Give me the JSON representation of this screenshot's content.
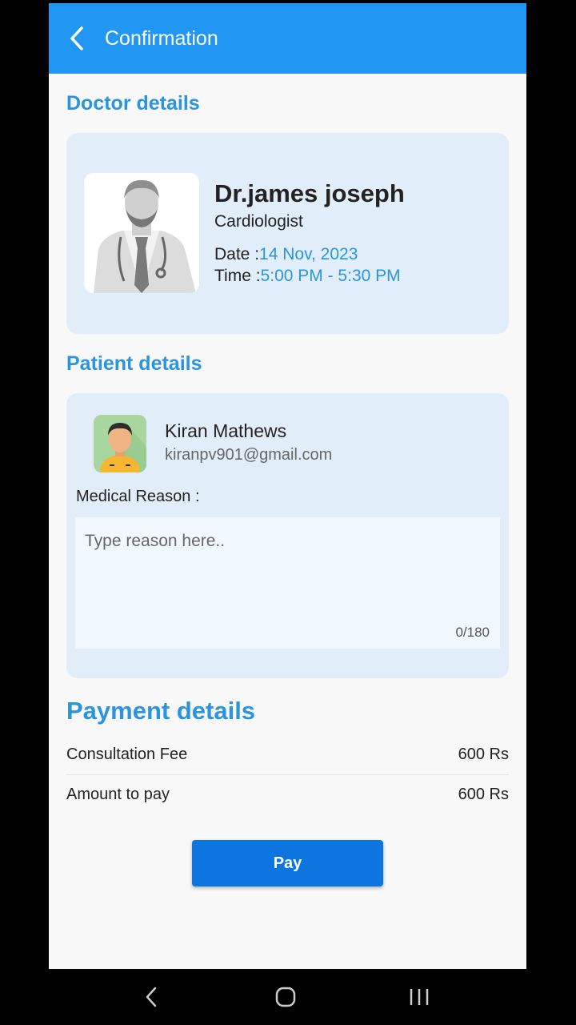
{
  "appbar": {
    "title": "Confirmation"
  },
  "doctor_section": {
    "heading": "Doctor details",
    "name": "Dr.james joseph",
    "specialty": "Cardiologist",
    "date_label": "Date :",
    "date_value": "14 Nov, 2023",
    "time_label": "Time :",
    "time_value": "5:00 PM - 5:30 PM"
  },
  "patient_section": {
    "heading": "Patient details",
    "name": "Kiran Mathews",
    "email": "kiranpv901@gmail.com",
    "reason_label": "Medical Reason :",
    "reason_placeholder": "Type reason here..",
    "reason_value": "",
    "counter": "0/180"
  },
  "payment": {
    "heading": "Payment details",
    "rows": [
      {
        "label": "Consultation Fee",
        "value": "600 Rs"
      },
      {
        "label": "Amount to pay",
        "value": "600 Rs"
      }
    ],
    "pay_label": "Pay"
  },
  "colors": {
    "primary": "#2196f3",
    "accent_text": "#2a95dd",
    "button": "#0c75e0",
    "card": "#e1eef9"
  },
  "icons": {
    "back": "back-arrow-icon",
    "nav_back": "nav-back-icon",
    "nav_home": "nav-home-icon",
    "nav_recents": "nav-recents-icon"
  }
}
